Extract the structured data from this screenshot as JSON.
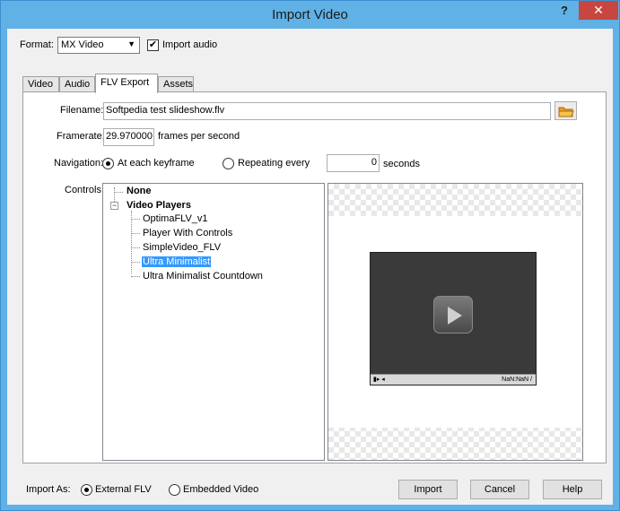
{
  "window": {
    "title": "Import Video",
    "help_glyph": "?",
    "close_glyph": "✕"
  },
  "format": {
    "label": "Format:",
    "selected": "MX Video",
    "import_audio_label": "Import audio",
    "import_audio_checked": true
  },
  "tabs": [
    {
      "label": "Video",
      "active": false
    },
    {
      "label": "Audio",
      "active": false
    },
    {
      "label": "FLV Export",
      "active": true
    },
    {
      "label": "Assets",
      "active": false
    }
  ],
  "filename": {
    "label": "Filename:",
    "value": "Softpedia test slideshow.flv"
  },
  "framerate": {
    "label": "Framerate:",
    "value": "29.970000",
    "unit": "frames per second"
  },
  "navigation": {
    "label": "Navigation:",
    "option_keyframe": "At each keyframe",
    "option_repeating": "Repeating every",
    "repeat_value": "0",
    "repeat_unit": "seconds",
    "selected": "keyframe"
  },
  "controls": {
    "label": "Controls:",
    "tree": {
      "none": "None",
      "group": "Video Players",
      "toggle": "−",
      "items": [
        "OptimaFLV_v1",
        "Player With Controls",
        "SimpleVideo_FLV",
        "Ultra Minimalist",
        "Ultra Minimalist Countdown"
      ],
      "selected_index": 3
    },
    "preview_time": "NaN:NaN /"
  },
  "import_as": {
    "label": "Import As:",
    "option_external": "External FLV",
    "option_embedded": "Embedded Video",
    "selected": "external"
  },
  "buttons": {
    "import": "Import",
    "cancel": "Cancel",
    "help": "Help"
  }
}
